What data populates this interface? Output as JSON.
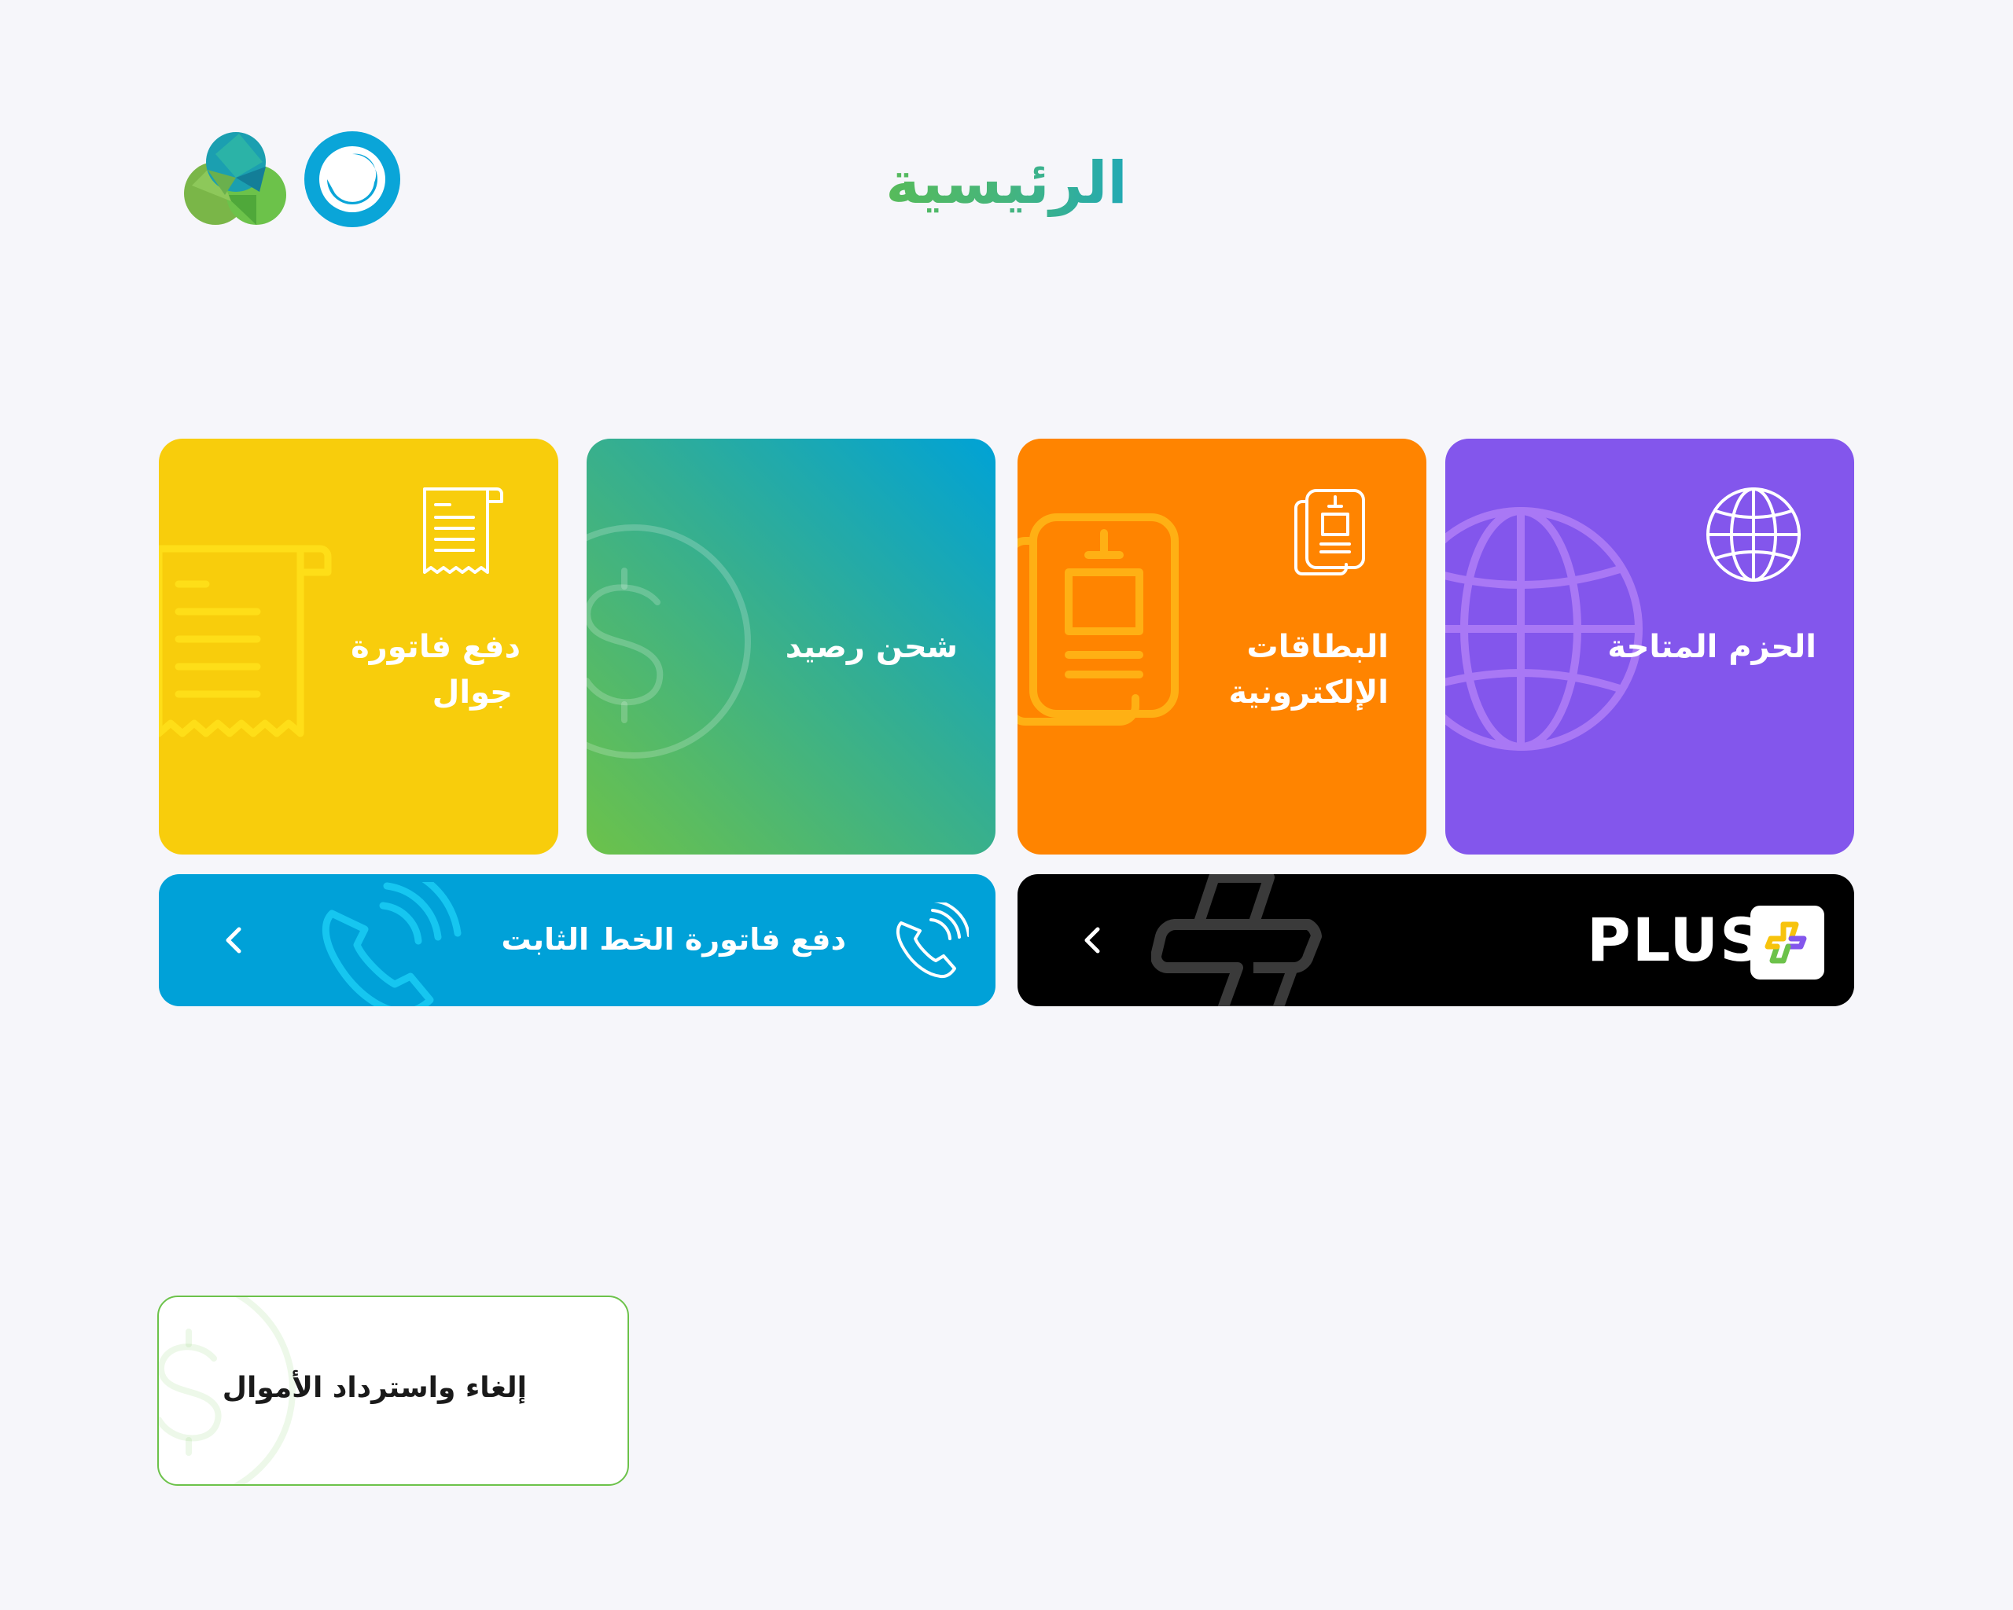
{
  "header": {
    "title": "الرئيسية",
    "logos": [
      "brand-logo-green-cluster",
      "brand-logo-blue-ring"
    ]
  },
  "tiles": [
    {
      "id": "bill",
      "label_line1": "دفع فاتورة",
      "label_line2": "جوال",
      "icon": "receipt-icon",
      "color": "#f8cd0c"
    },
    {
      "id": "recharge",
      "label": "شحن رصيد",
      "icon": "dollar-icon",
      "gradient": [
        "#6cc24a",
        "#00a2d6"
      ]
    },
    {
      "id": "ecards",
      "label_line1": "البطاقات",
      "label_line2": "الإلكترونية",
      "icon": "sim-cards-icon",
      "color": "#ff8400"
    },
    {
      "id": "packages",
      "label": "الحزم المتاحة",
      "icon": "globe-icon",
      "color": "#8356ec"
    }
  ],
  "banners": {
    "landline": {
      "label": "دفع فاتورة الخط الثابت",
      "icon": "phone-ringing-icon",
      "color": "#00a1d8"
    },
    "plus": {
      "label": "PLUS",
      "icon": "plus-logo-icon",
      "color": "#000000"
    }
  },
  "refund": {
    "label": "إلغاء واسترداد الأموال",
    "icon": "dollar-icon",
    "border_color": "#6cc24a"
  }
}
